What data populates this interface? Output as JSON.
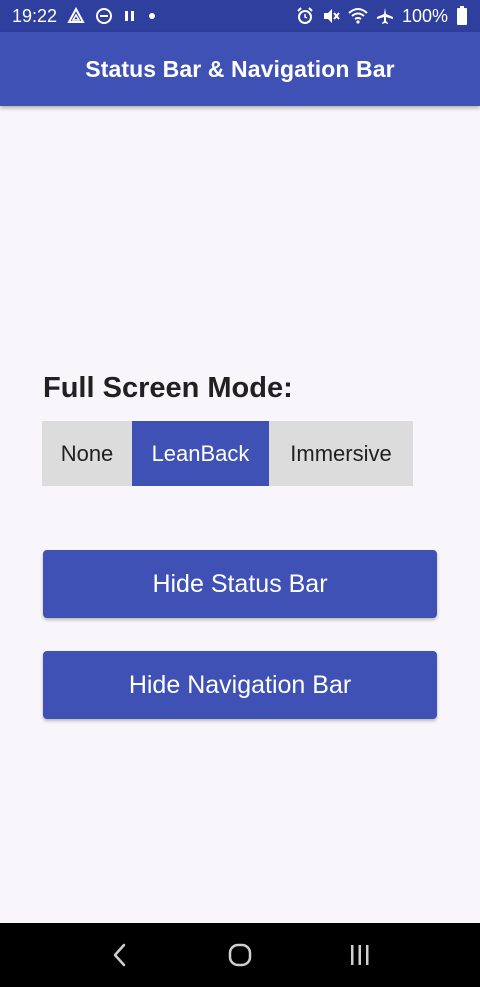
{
  "status_bar": {
    "time": "19:22",
    "battery": "100%",
    "icons_left": [
      "pie-icon",
      "do-not-disturb-icon",
      "pause-icon",
      "dot-icon"
    ],
    "icons_right": [
      "alarm-icon",
      "mute-icon",
      "wifi-icon",
      "airplane-icon",
      "battery-icon"
    ]
  },
  "app_bar": {
    "title": "Status Bar & Navigation Bar"
  },
  "main": {
    "heading": "Full Screen Mode:",
    "modes": [
      {
        "label": "None",
        "selected": false
      },
      {
        "label": "LeanBack",
        "selected": true
      },
      {
        "label": "Immersive",
        "selected": false
      }
    ],
    "hide_status_button": "Hide Status Bar",
    "hide_navigation_button": "Hide Navigation Bar"
  },
  "nav_bar": {
    "keys": [
      "back-icon",
      "home-icon",
      "recents-icon"
    ]
  },
  "colors": {
    "primary": "#3f51b5",
    "primary_dark": "#2f3f9e",
    "toggle_unselected": "#dcdcdc",
    "background": "#f8f6fa"
  }
}
